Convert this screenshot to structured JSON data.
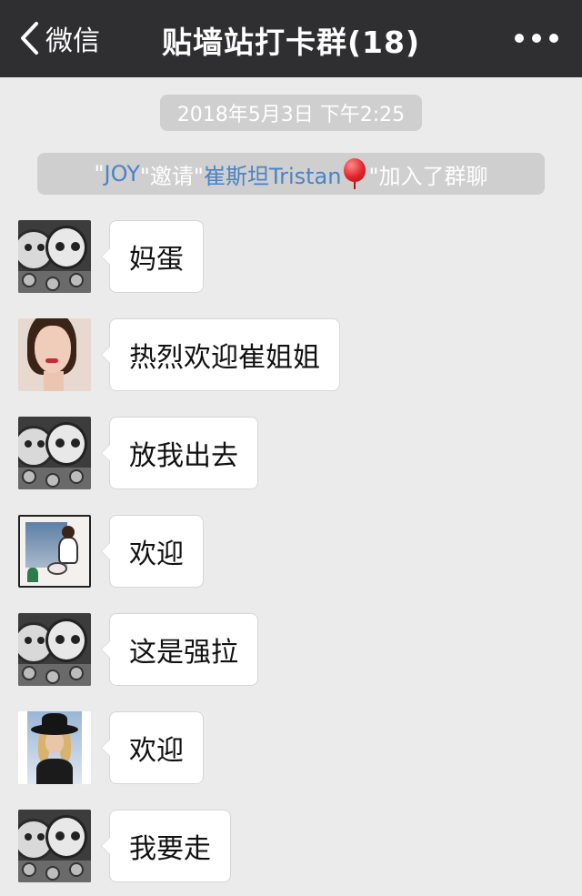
{
  "header": {
    "back_label": "微信",
    "title": "贴墙站打卡群(18)"
  },
  "timestamp": "2018年5月3日 下午2:25",
  "system_notice": {
    "quote_open": "\"",
    "inviter": "JOY",
    "mid": "\"邀请\"",
    "invitee": "崔斯坦Tristan",
    "tail": " \"加入了群聊"
  },
  "messages": [
    {
      "avatar": "cartoon-avatar",
      "text": "妈蛋"
    },
    {
      "avatar": "woman-portrait-avatar",
      "text": "热烈欢迎崔姐姐"
    },
    {
      "avatar": "cartoon-avatar",
      "text": "放我出去"
    },
    {
      "avatar": "illustration-avatar",
      "text": "欢迎"
    },
    {
      "avatar": "cartoon-avatar",
      "text": "这是强拉"
    },
    {
      "avatar": "hat-woman-avatar",
      "text": "欢迎"
    },
    {
      "avatar": "cartoon-avatar",
      "text": "我要走"
    }
  ],
  "colors": {
    "navbar": "#2f2f31",
    "background": "#ebebeb",
    "highlight_name": "#4a83c6"
  }
}
